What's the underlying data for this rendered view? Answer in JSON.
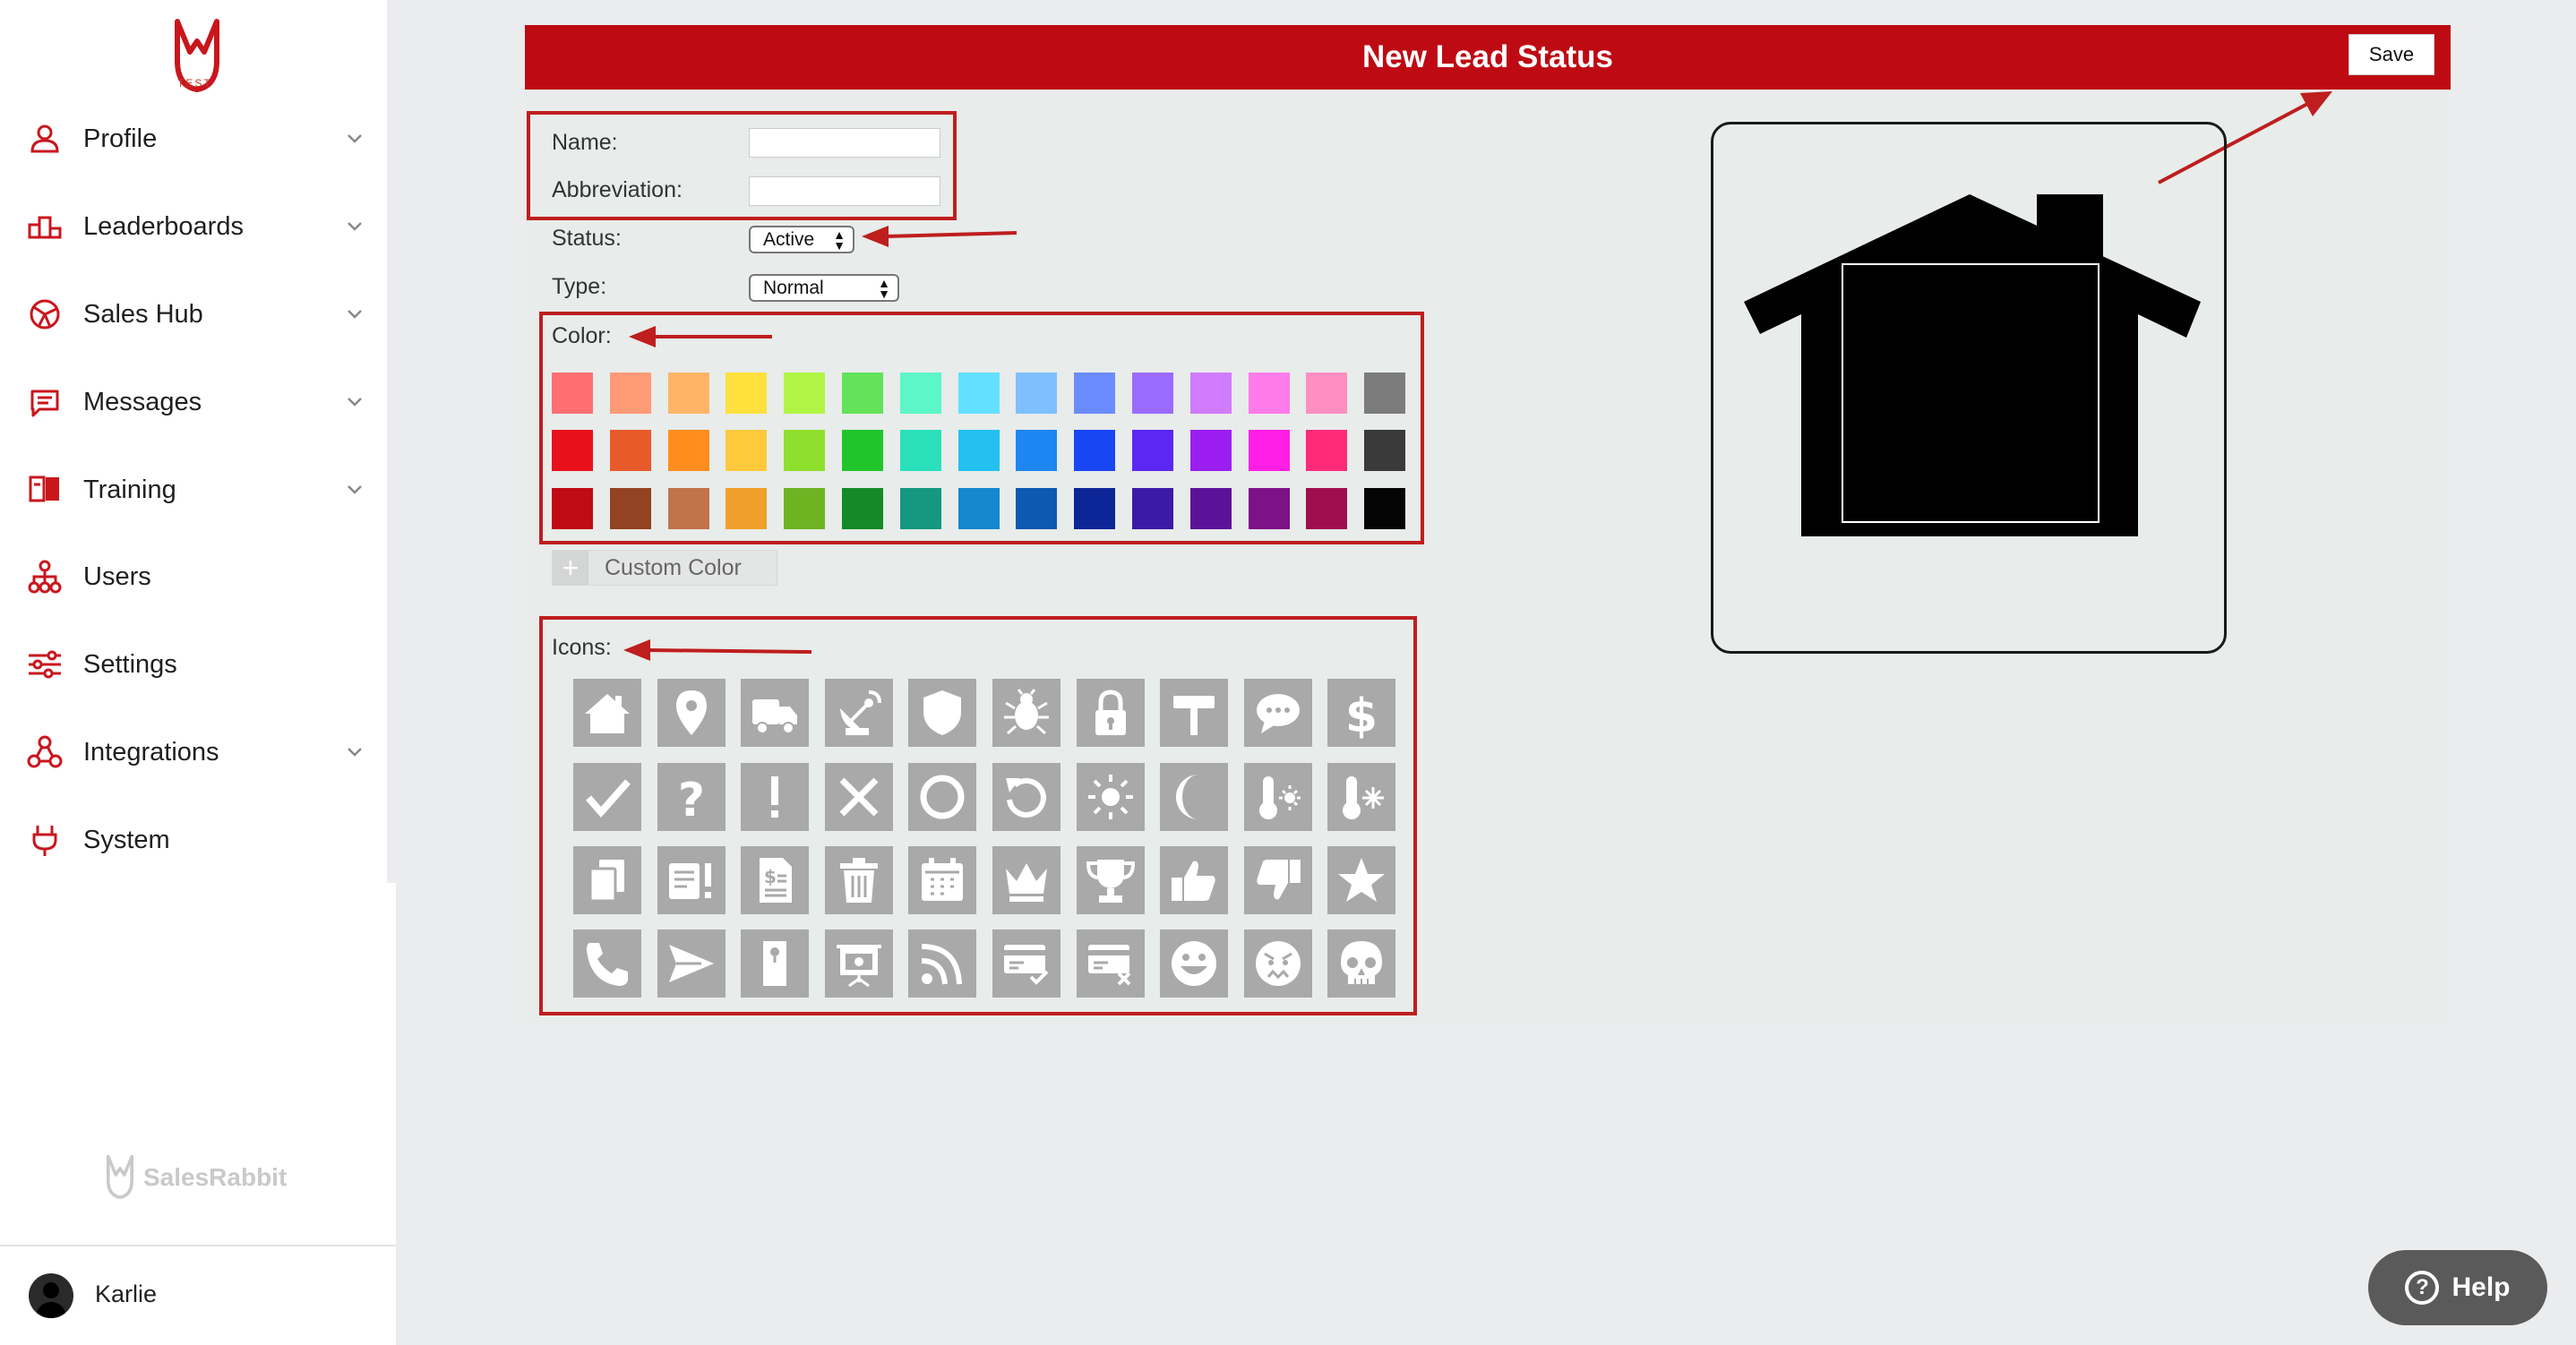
{
  "sidebar": {
    "logo_caption": "TEST",
    "items": [
      {
        "label": "Profile",
        "icon": "person-icon",
        "expandable": true
      },
      {
        "label": "Leaderboards",
        "icon": "podium-icon",
        "expandable": true
      },
      {
        "label": "Sales Hub",
        "icon": "globe-icon",
        "expandable": true
      },
      {
        "label": "Messages",
        "icon": "chat-icon",
        "expandable": true
      },
      {
        "label": "Training",
        "icon": "book-icon",
        "expandable": true
      },
      {
        "label": "Users",
        "icon": "org-chart-icon",
        "expandable": false
      },
      {
        "label": "Settings",
        "icon": "sliders-icon",
        "expandable": false
      },
      {
        "label": "Integrations",
        "icon": "nodes-icon",
        "expandable": true
      },
      {
        "label": "System",
        "icon": "plug-icon",
        "expandable": false
      }
    ],
    "brand": "SalesRabbit",
    "user_name": "Karlie"
  },
  "header": {
    "title": "New Lead Status",
    "save_label": "Save"
  },
  "form": {
    "name_label": "Name:",
    "name_value": "",
    "abbreviation_label": "Abbreviation:",
    "abbreviation_value": "",
    "status_label": "Status:",
    "status_value": "Active",
    "type_label": "Type:",
    "type_value": "Normal",
    "color_label": "Color:",
    "custom_color_label": "Custom Color",
    "icons_label": "Icons:"
  },
  "colors": [
    [
      "#ff6f73",
      "#ff9a76",
      "#ffb565",
      "#ffe03c",
      "#b0f545",
      "#63e25a",
      "#5cf6c8",
      "#63e0ff",
      "#7fbfff",
      "#6b8cff",
      "#9b6bff",
      "#d17bff",
      "#ff7bea",
      "#ff8fc0",
      "#7c7c7c"
    ],
    [
      "#e8111b",
      "#e95a2a",
      "#ff8c1f",
      "#ffc93c",
      "#8fe02e",
      "#1fc52b",
      "#29e0bb",
      "#23c0f0",
      "#1d86f0",
      "#1846f2",
      "#5b27f2",
      "#9a1ef0",
      "#ff1ee5",
      "#ff2b7a",
      "#3a3a3a"
    ],
    [
      "#c00a14",
      "#924322",
      "#c1744a",
      "#f0a02a",
      "#6fb323",
      "#138a26",
      "#149880",
      "#1588ce",
      "#0d58b0",
      "#0c2597",
      "#3b1aa7",
      "#5c1199",
      "#7d1186",
      "#a10d4f",
      "#050505"
    ]
  ],
  "icons": [
    [
      "house-icon",
      "map-pin-icon",
      "truck-icon",
      "satellite-dish-icon",
      "shield-icon",
      "bug-icon",
      "lock-icon",
      "signpost-icon",
      "speech-bubble-icon",
      "dollar-icon"
    ],
    [
      "check-icon",
      "question-icon",
      "exclamation-icon",
      "x-icon",
      "circle-icon",
      "refresh-icon",
      "sun-icon",
      "moon-icon",
      "thermometer-hot-icon",
      "thermometer-cold-icon"
    ],
    [
      "copy-document-icon",
      "alert-document-icon",
      "invoice-icon",
      "trash-icon",
      "calendar-icon",
      "crown-icon",
      "trophy-icon",
      "thumbs-up-icon",
      "thumbs-down-icon",
      "star-icon"
    ],
    [
      "phone-icon",
      "send-icon",
      "door-hanger-icon",
      "presentation-icon",
      "rss-icon",
      "card-approved-icon",
      "card-declined-icon",
      "happy-face-icon",
      "angry-face-icon",
      "skull-icon"
    ]
  ],
  "preview": {
    "icon": "house-icon",
    "color": "#000000"
  },
  "help": {
    "label": "Help"
  }
}
